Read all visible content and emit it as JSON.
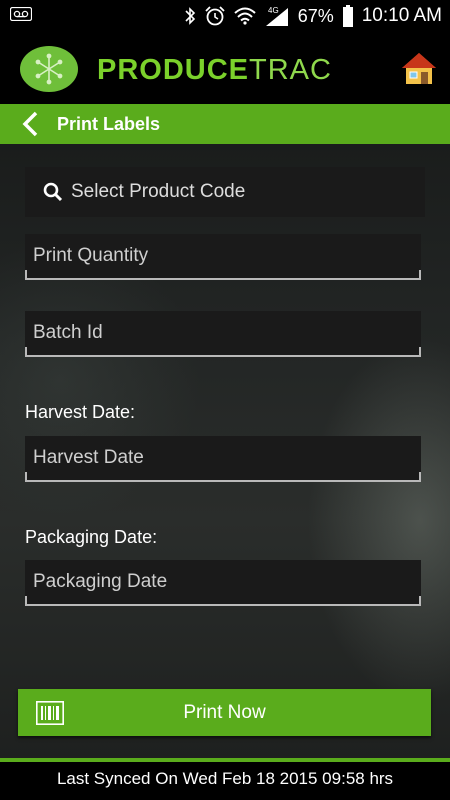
{
  "status_bar": {
    "battery": "67%",
    "network": "4G",
    "time": "10:10 AM",
    "icons": [
      "voicemail-icon",
      "bluetooth-icon",
      "alarm-icon",
      "wifi-icon",
      "signal-icon",
      "battery-icon"
    ]
  },
  "header": {
    "brand_part1": "PRODUCE",
    "brand_part2": "TRAC",
    "logo_icon": "asterisk-logo-icon",
    "home_icon": "home-icon"
  },
  "titlebar": {
    "title": "Print Labels",
    "back_icon": "chevron-left-icon"
  },
  "form": {
    "product_code_placeholder": "Select Product Code",
    "print_quantity_placeholder": "Print Quantity",
    "batch_id_placeholder": "Batch Id",
    "harvest_label": "Harvest Date:",
    "harvest_placeholder": "Harvest Date",
    "packaging_label": "Packaging Date:",
    "packaging_placeholder": "Packaging Date"
  },
  "actions": {
    "print_label": "Print Now",
    "print_icon": "barcode-icon"
  },
  "footer": {
    "sync_text": "Last Synced On Wed Feb 18 2015 09:58 hrs"
  },
  "colors": {
    "accent_green": "#5aac1c",
    "brand_green": "#7bd12b",
    "background": "#1b1d1c"
  }
}
